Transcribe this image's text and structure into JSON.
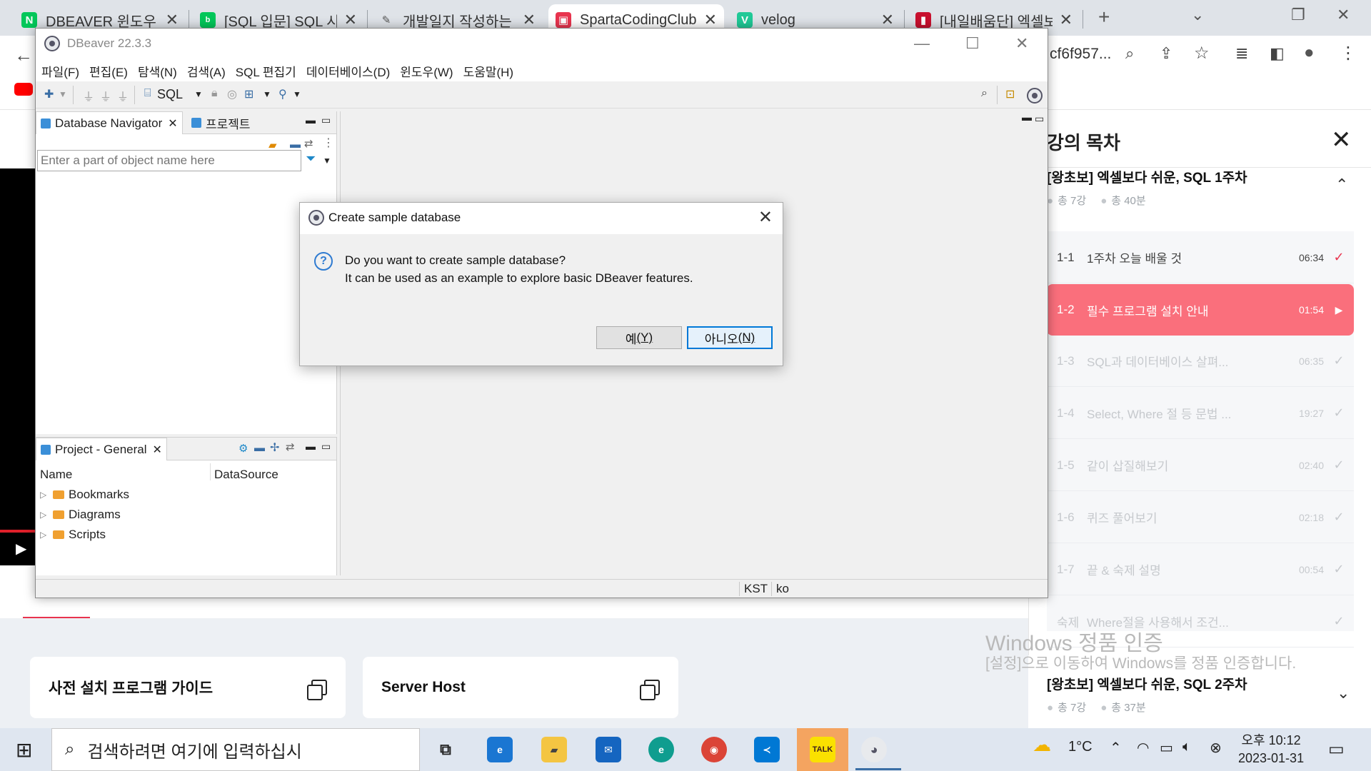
{
  "browser": {
    "tabs": [
      {
        "title": "DBEAVER 윈도우 설",
        "icon": "naver-icon",
        "color": "#03c75a",
        "glyph": "N"
      },
      {
        "title": "[SQL 입문] SQL 시",
        "icon": "blog-icon",
        "color": "#03c75a",
        "glyph": "b"
      },
      {
        "title": "개발일지 작성하는",
        "icon": "pen-icon",
        "color": "#555555",
        "glyph": "✎"
      },
      {
        "title": "SpartaCodingClub",
        "icon": "sparta-icon",
        "color": "#e8344e",
        "glyph": "▣"
      },
      {
        "title": "velog",
        "icon": "velog-icon",
        "color": "#20c997",
        "glyph": "V"
      },
      {
        "title": "[내일배움단] 엑셀보",
        "icon": "book-icon",
        "color": "#c8102e",
        "glyph": "▮"
      }
    ],
    "new_tab": "+",
    "address_fragment": "cf6f957..."
  },
  "dbeaver": {
    "window_title": "DBeaver 22.3.3",
    "menu": [
      "파일(F)",
      "편집(E)",
      "탐색(N)",
      "검색(A)",
      "SQL 편집기",
      "데이터베이스(D)",
      "윈도우(W)",
      "도움말(H)"
    ],
    "toolbar_sql": "SQL",
    "navigator_tab": "Database Navigator",
    "project_tab": "프로젝트",
    "search_placeholder": "Enter a part of object name here",
    "project_general_tab": "Project - General",
    "columns": {
      "name": "Name",
      "datasource": "DataSource"
    },
    "tree": [
      "Bookmarks",
      "Diagrams",
      "Scripts"
    ],
    "status": {
      "tz": "KST",
      "lang": "ko"
    }
  },
  "dialog": {
    "title": "Create sample database",
    "line1": "Do you want to create sample database?",
    "line2": "It can be used as an example to explore basic DBeaver features.",
    "yes_label": "예",
    "yes_key": "(Y)",
    "no_label": "아니오",
    "no_key": "(N)"
  },
  "course": {
    "panel_title": "강의 목차",
    "week1": {
      "title": "[왕초보] 엑셀보다 쉬운, SQL 1주차",
      "count": "총 7강",
      "duration": "총 40분"
    },
    "lessons": [
      {
        "num": "1-1",
        "name": "1주차 오늘 배울 것",
        "time": "06:34",
        "state": "done"
      },
      {
        "num": "1-2",
        "name": "필수 프로그램 설치 안내",
        "time": "01:54",
        "state": "active"
      },
      {
        "num": "1-3",
        "name": "SQL과 데이터베이스 살펴...",
        "time": "06:35",
        "state": "dim"
      },
      {
        "num": "1-4",
        "name": "Select, Where 절 등 문법 ...",
        "time": "19:27",
        "state": "dim"
      },
      {
        "num": "1-5",
        "name": "같이 삽질해보기",
        "time": "02:40",
        "state": "dim"
      },
      {
        "num": "1-6",
        "name": "퀴즈 풀어보기",
        "time": "02:18",
        "state": "dim"
      },
      {
        "num": "1-7",
        "name": "끝 & 숙제 설명",
        "time": "00:54",
        "state": "dim"
      },
      {
        "num": "숙제",
        "name": "Where절을 사용해서 조건...",
        "time": "",
        "state": "dim"
      }
    ],
    "week2": {
      "title": "[왕초보] 엑셀보다 쉬운, SQL 2주차",
      "count": "총 7강",
      "duration": "총 37분"
    },
    "cards": [
      "사전 설치 프로그램 가이드",
      "Server Host"
    ]
  },
  "watermark": {
    "line1": "Windows 정품 인증",
    "line2": "[설정]으로 이동하여 Windows를 정품 인증합니다."
  },
  "taskbar": {
    "search_placeholder": "검색하려면 여기에 입력하십시",
    "weather": "1°C",
    "time": "오후 10:12",
    "date": "2023-01-31"
  }
}
